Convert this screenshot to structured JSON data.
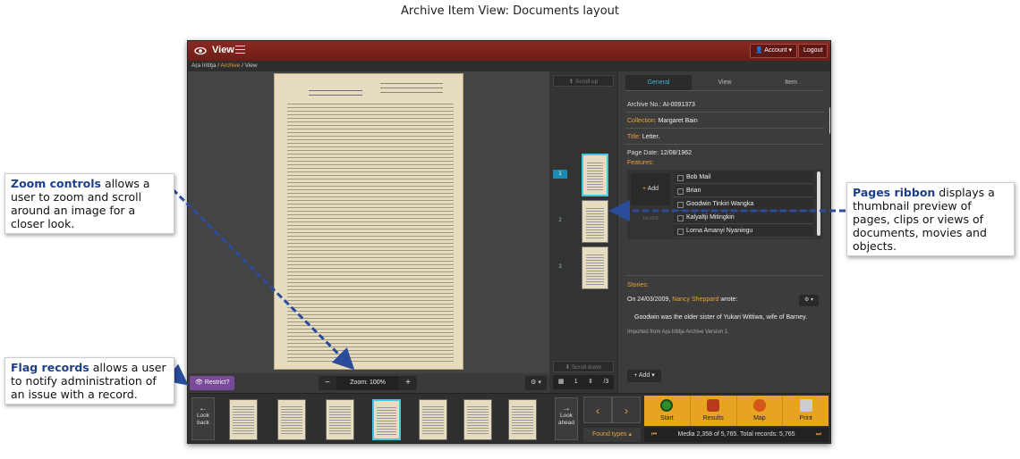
{
  "figure_title": "Archive Item View: Documents layout",
  "topbar": {
    "view_label": "View",
    "account_label": "Account",
    "logout_label": "Logout"
  },
  "breadcrumb": {
    "root": "Aṟa Irititja",
    "archive": "Archive",
    "current": "View"
  },
  "zoom": {
    "minus": "−",
    "label": "Zoom: 100%",
    "plus": "+"
  },
  "restrict_label": "Restrict?",
  "gear_label": "⚙ ▾",
  "ribbon": {
    "scroll_up": "Scroll up",
    "scroll_down": "Scroll down",
    "pages": [
      "1",
      "2",
      "3"
    ],
    "pager_current": "1",
    "pager_total": "/3"
  },
  "panel": {
    "tabs": [
      "General",
      "View",
      "Item"
    ],
    "archive_no_label": "Archive No.:",
    "archive_no": "AI-0091373",
    "collection_label": "Collection:",
    "collection": "Margaret Bain",
    "title_label": "Title:",
    "title": "Letter.",
    "page_date_label": "Page Date:",
    "page_date": "12/08/1962",
    "features_label": "Features:",
    "add_label": "Add",
    "record_label": "record",
    "features": [
      "Bob Mail",
      "Brian",
      "Goodwin Tinkiri Wangka",
      "Kalyaltji Mitingkiri",
      "Lorna Amanyi Nyaningu"
    ],
    "stories_label": "Stories:",
    "story_prefix": "On 24/03/2009,",
    "story_author": "Nancy Sheppard",
    "story_suffix": "wrote:",
    "story_text": "Goodwin was the older sister of Yukari Wittiwa, wife of Barney.",
    "story_imported": "Imported from Aṟa Irititja Archive Version 1.",
    "add_button": "+ Add"
  },
  "bottom": {
    "look_back": "Look back",
    "look_ahead": "Look ahead",
    "found_types": "Found types",
    "actions": [
      "Start",
      "Results",
      "Map",
      "Print"
    ],
    "media_text": "Media 2,358 of 5,765. Total records: 5,765"
  },
  "callouts": {
    "zoom": {
      "keyword": "Zoom controls",
      "text": " allows a user to zoom and scroll around an image for a closer look."
    },
    "flag": {
      "keyword": "Flag records",
      "text": " allows a user to notify administration of an issue with a record."
    },
    "pages": {
      "keyword": "Pages ribbon",
      "text": " displays a thumbnail preview of pages, clips or views of documents, movies and objects."
    }
  }
}
